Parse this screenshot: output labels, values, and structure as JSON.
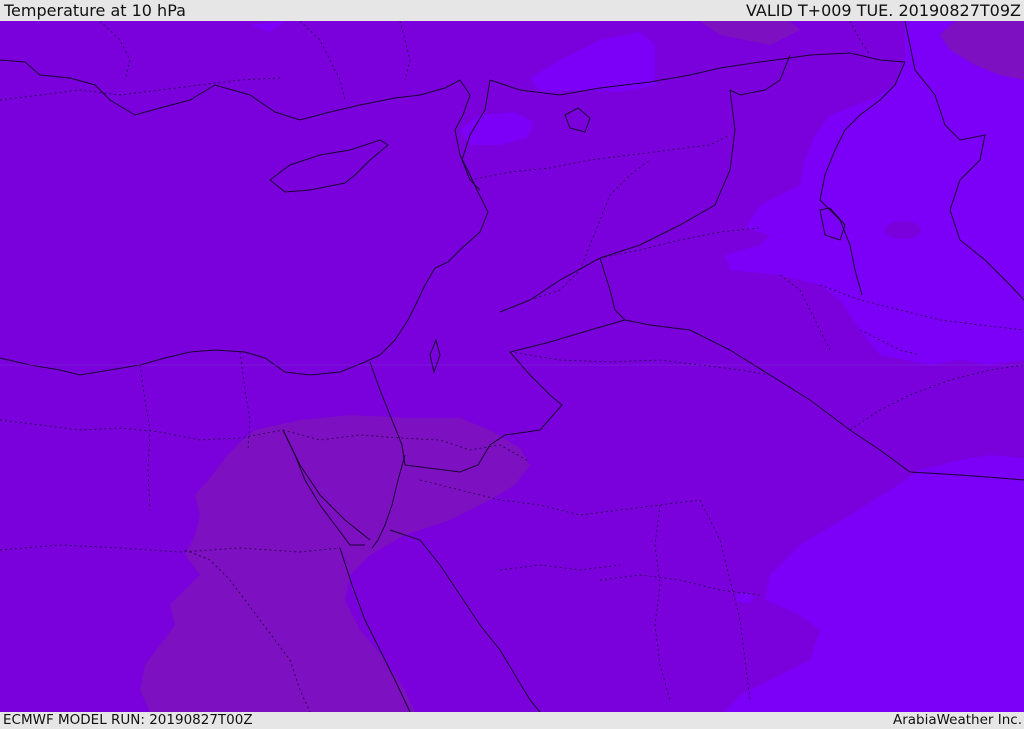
{
  "header": {
    "title": "Temperature at 10 hPa",
    "valid_time": "VALID T+009 TUE. 20190827T09Z"
  },
  "footer": {
    "model_run": "ECMWF MODEL RUN: 20190827T00Z",
    "credit": "ArabiaWeather Inc."
  },
  "colors": {
    "base_field": "#7a00dc",
    "warm_field": "#7d10c0",
    "cool_field": "#7c00f8",
    "chrome": "#e6e6e6",
    "border_line": "#1a0033"
  }
}
